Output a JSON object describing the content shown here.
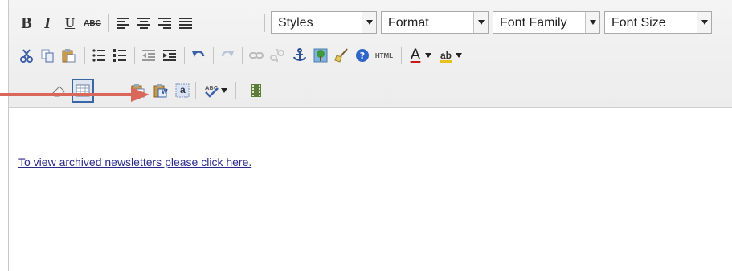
{
  "toolbar": {
    "row1": {
      "bold_label": "B",
      "italic_label": "I",
      "underline_label": "U",
      "strike_label": "ABC",
      "styles_label": "Styles",
      "format_label": "Format",
      "font_family_label": "Font Family",
      "font_size_label": "Font Size"
    },
    "row2": {
      "html_label": "HTML",
      "text_color_label": "A",
      "highlight_label": "ab"
    },
    "row3": {
      "paste_word_badge": "W",
      "paste_text_badge": "a"
    }
  },
  "content": {
    "link_text": "To view archived newsletters please click here."
  },
  "colors": {
    "arrow": "#d9675a",
    "link": "#2b2b8c",
    "active_border": "#3a67a4"
  }
}
